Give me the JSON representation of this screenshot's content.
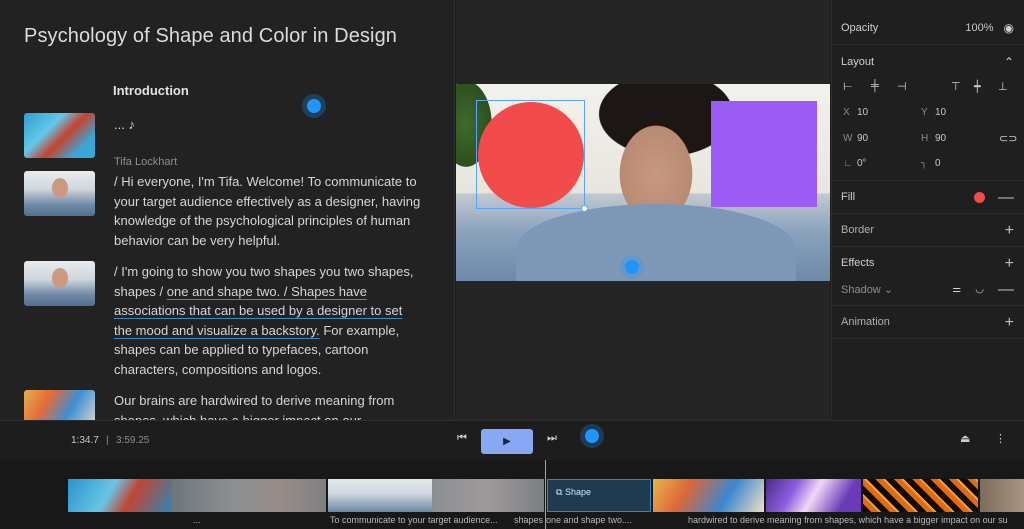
{
  "script": {
    "title": "Psychology of Shape and Color in Design",
    "section": "Introduction",
    "music_note": "... ♪",
    "speaker": "Tifa Lockhart",
    "para1": "/ Hi everyone, I'm Tifa. Welcome! To communicate to your target audience effectively as a designer, having knowledge of the psychological principles of human behavior can be very helpful.",
    "para2_a": "/ I'm going to show you two shapes you two shapes, shapes / ",
    "para2_hl": "one and shape two. / Shapes have associations that can be used by a designer to set the mood and visualize a backstory.",
    "para2_b": " For example, shapes can be applied to typefaces, cartoon characters, compositions and logos.",
    "para3": "Our brains are hardwired to derive meaning from shapes, which have a bigger impact on our"
  },
  "properties": {
    "opacity_label": "Opacity",
    "opacity_value": "100%",
    "layout_label": "Layout",
    "x_label": "X",
    "x_value": "10",
    "y_label": "Y",
    "y_value": "10",
    "w_label": "W",
    "w_value": "90",
    "h_label": "H",
    "h_value": "90",
    "rotation_value": "0°",
    "radius_value": "0",
    "fill_label": "Fill",
    "fill_color": "#f24b4b",
    "border_label": "Border",
    "effects_label": "Effects",
    "shadow_label": "Shadow",
    "animation_label": "Animation"
  },
  "player": {
    "current_time": "1:34.7",
    "total_time": "3:59.25"
  },
  "timeline": {
    "shape_clip_label": "Shape",
    "captions": [
      "...",
      "To communicate to your target audience...",
      "shapes",
      "one and shape two....",
      "hardwired to derive meaning from shapes, which have a bigger impact on our su"
    ]
  },
  "colors": {
    "accent": "#89a8f4",
    "circle": "#f24b4b",
    "square": "#9b5cf5",
    "selection": "#59a6ff",
    "cursor": "#1e96ff"
  }
}
